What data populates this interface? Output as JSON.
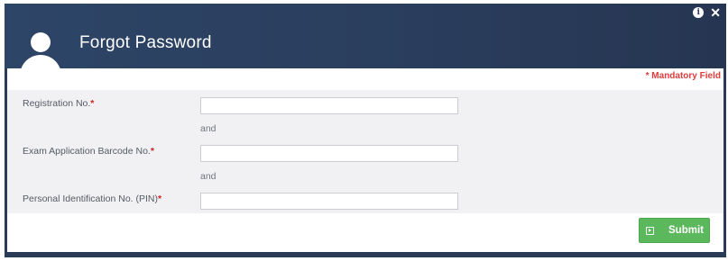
{
  "header": {
    "title": "Forgot Password",
    "icons": [
      "user-avatar-icon",
      "info-icon",
      "close-icon"
    ]
  },
  "mandatory_note": "* Mandatory Field",
  "form": {
    "fields": [
      {
        "label": "Registration No.",
        "required_mark": "*",
        "value": ""
      },
      {
        "label": "Exam Application Barcode No.",
        "required_mark": "*",
        "value": ""
      },
      {
        "label": "Personal Identification No. (PIN)",
        "required_mark": "*",
        "value": ""
      }
    ],
    "separators": [
      "and",
      "and"
    ]
  },
  "footer": {
    "submit_label": "Submit"
  },
  "colors": {
    "header_bg": "#2b3f5f",
    "mandatory": "#e03a3a",
    "submit_bg": "#5cb85c"
  }
}
